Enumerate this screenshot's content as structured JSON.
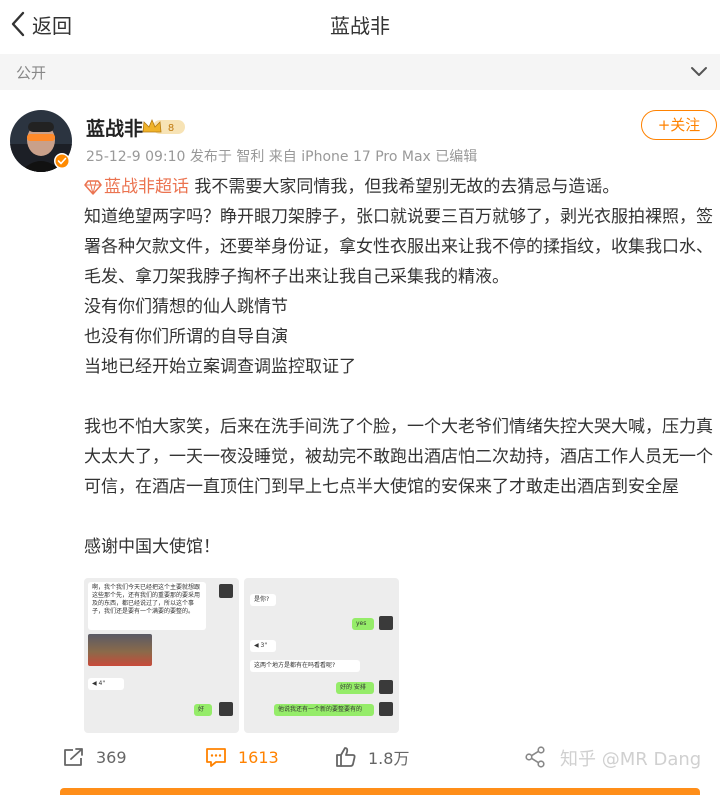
{
  "header": {
    "back_label": "返回",
    "title": "蓝战非"
  },
  "visibility": {
    "label": "公开"
  },
  "author": {
    "name": "蓝战非",
    "vip_level": "8",
    "meta": "25-12-9 09:10  发布于 智利  来自 iPhone 17 Pro Max 已编辑",
    "follow_label": "+关注"
  },
  "post": {
    "topic": "蓝战非超话",
    "lines": [
      "我不需要大家同情我，但我希望别无故的去猜忌与造谣。",
      "知道绝望两字吗？睁开眼刀架脖子，张口就说要三百万就够了，剥光衣服拍裸照，签署各种欠款文件，还要举身份证，拿女性衣服出来让我不停的揉指纹，收集我口水、毛发、拿刀架我脖子掏杯子出来让我自己采集我的精液。",
      "没有你们猜想的仙人跳情节",
      "也没有你们所谓的自导自演",
      "当地已经开始立案调查调监控取证了",
      "我也不怕大家笑，后来在洗手间洗了个脸，一个大老爷们情绪失控大哭大喊，压力真大太大了，一天一夜没睡觉，被劫完不敢跑出酒店怕二次劫持，酒店工作人员无一个可信，在酒店一直顶住门到早上七点半大使馆的安保来了才敢走出酒店到安全屋",
      "感谢中国大使馆！"
    ]
  },
  "images": {
    "pic1": {
      "bubble1": "啊，我个我们今天已经把这个主要就想跟这些那个先，还有我们的重要那的要采用及的东西，都已经说过了，所以这个事子，我们还是要有一个满要的要整的。",
      "bubble2": "◀ 4\"",
      "bubble3": "好"
    },
    "pic2": {
      "bubble1": "是你?",
      "bubble2": "yes",
      "bubble3": "◀ 3\"",
      "bubble4": "这两个地方是都有在吗看看呢?",
      "bubble5": "好的 安排",
      "bubble6": "他说我还有一个新的要整要有的"
    }
  },
  "actions": {
    "repost_count": "369",
    "comment_count": "1613",
    "like_count": "1.8万"
  },
  "watermark": "知乎 @MR Dang",
  "colors": {
    "accent": "#ff8200",
    "topic": "#eb7350",
    "meta": "#999999"
  },
  "icons": [
    "chevron-left-icon",
    "chevron-down-icon",
    "vip-crown-icon",
    "topic-diamond-icon",
    "repost-icon",
    "comment-icon",
    "like-icon",
    "share-icon"
  ]
}
